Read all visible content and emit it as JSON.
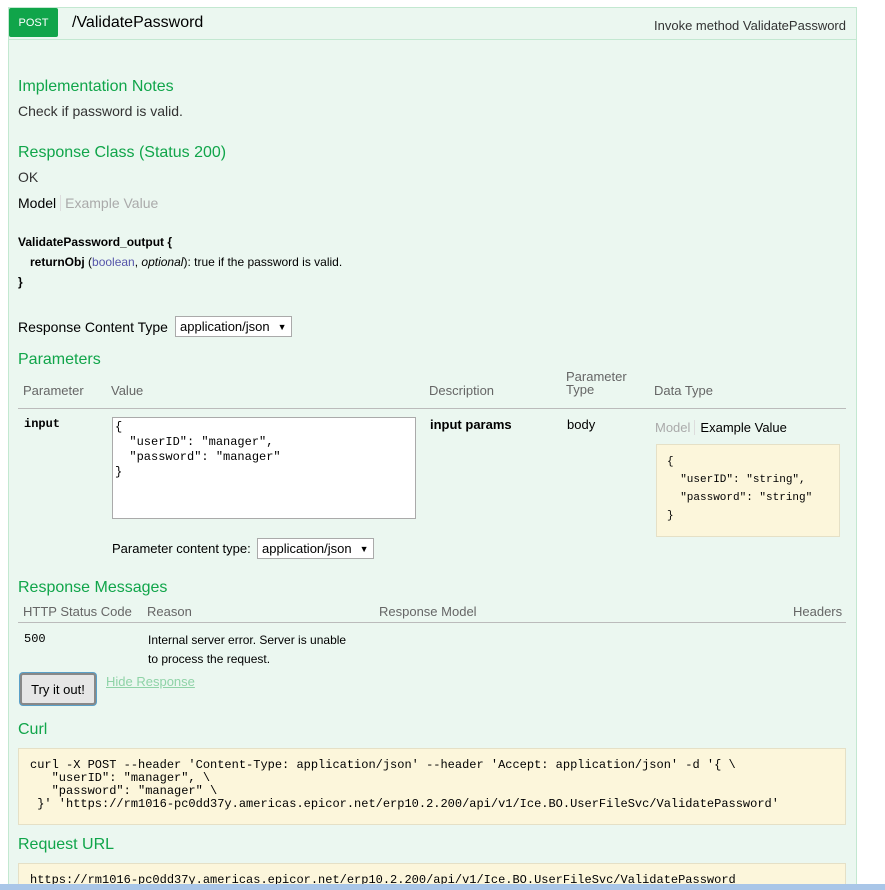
{
  "operation": {
    "method": "POST",
    "path": "/ValidatePassword",
    "summary": "Invoke method ValidatePassword"
  },
  "implementation_notes": {
    "heading": "Implementation Notes",
    "text": "Check if password is valid."
  },
  "response_class": {
    "heading": "Response Class (Status 200)",
    "text": "OK",
    "tabs": [
      "Model",
      "Example Value"
    ],
    "model_name": "ValidatePassword_output {",
    "field_name": "returnObj",
    "field_type": "boolean",
    "field_optional": "optional",
    "field_desc": "): true if the password is valid.",
    "open_paren": " (",
    "comma": ", ",
    "close": "}"
  },
  "response_content_type": {
    "label": "Response Content Type",
    "value": "application/json"
  },
  "parameters": {
    "heading": "Parameters",
    "columns": [
      "Parameter",
      "Value",
      "Description",
      "Parameter Type",
      "Data Type"
    ],
    "row": {
      "name": "input",
      "value": "{\n  \"userID\": \"manager\",\n  \"password\": \"manager\"\n}",
      "description": "input params",
      "param_type": "body",
      "datatype_tabs": [
        "Model",
        "Example Value"
      ],
      "example": "{\n  \"userID\": \"string\",\n  \"password\": \"string\"\n}"
    },
    "content_type_label": "Parameter content type:",
    "content_type_value": "application/json"
  },
  "response_messages": {
    "heading": "Response Messages",
    "columns": [
      "HTTP Status Code",
      "Reason",
      "Response Model",
      "Headers"
    ],
    "rows": [
      {
        "code": "500",
        "reason_line1": "Internal server error. Server is unable",
        "reason_line2": "to process the request."
      }
    ]
  },
  "actions": {
    "try_label": "Try it out!",
    "hide_label": "Hide Response"
  },
  "curl": {
    "heading": "Curl",
    "command": "curl -X POST --header 'Content-Type: application/json' --header 'Accept: application/json' -d '{ \\\n   \"userID\": \"manager\", \\\n   \"password\": \"manager\" \\\n }' 'https://rm1016-pc0dd37y.americas.epicor.net/erp10.2.200/api/v1/Ice.BO.UserFileSvc/ValidatePassword'"
  },
  "request_url": {
    "heading": "Request URL",
    "url": "https://rm1016-pc0dd37y.americas.epicor.net/erp10.2.200/api/v1/Ice.BO.UserFileSvc/ValidatePassword"
  },
  "colors": {
    "accent_green": "#10a54a",
    "panel_bg": "#ebf7f0",
    "code_bg": "#fcf6db"
  }
}
